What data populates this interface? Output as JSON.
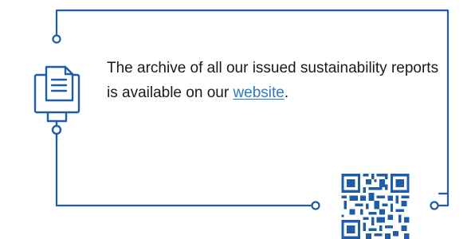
{
  "message": {
    "text_before_link": "The archive of all our issued sustainability reports is available on our ",
    "link_text": "website",
    "text_after_link": "."
  },
  "colors": {
    "frame_line": "#1f5ea6",
    "link": "#2a7bc0",
    "text": "#1a1a1a",
    "qr_modules": "#1f5ea6"
  },
  "icons": {
    "document_monitor": "document-on-monitor-icon",
    "qr": "qr-code"
  }
}
